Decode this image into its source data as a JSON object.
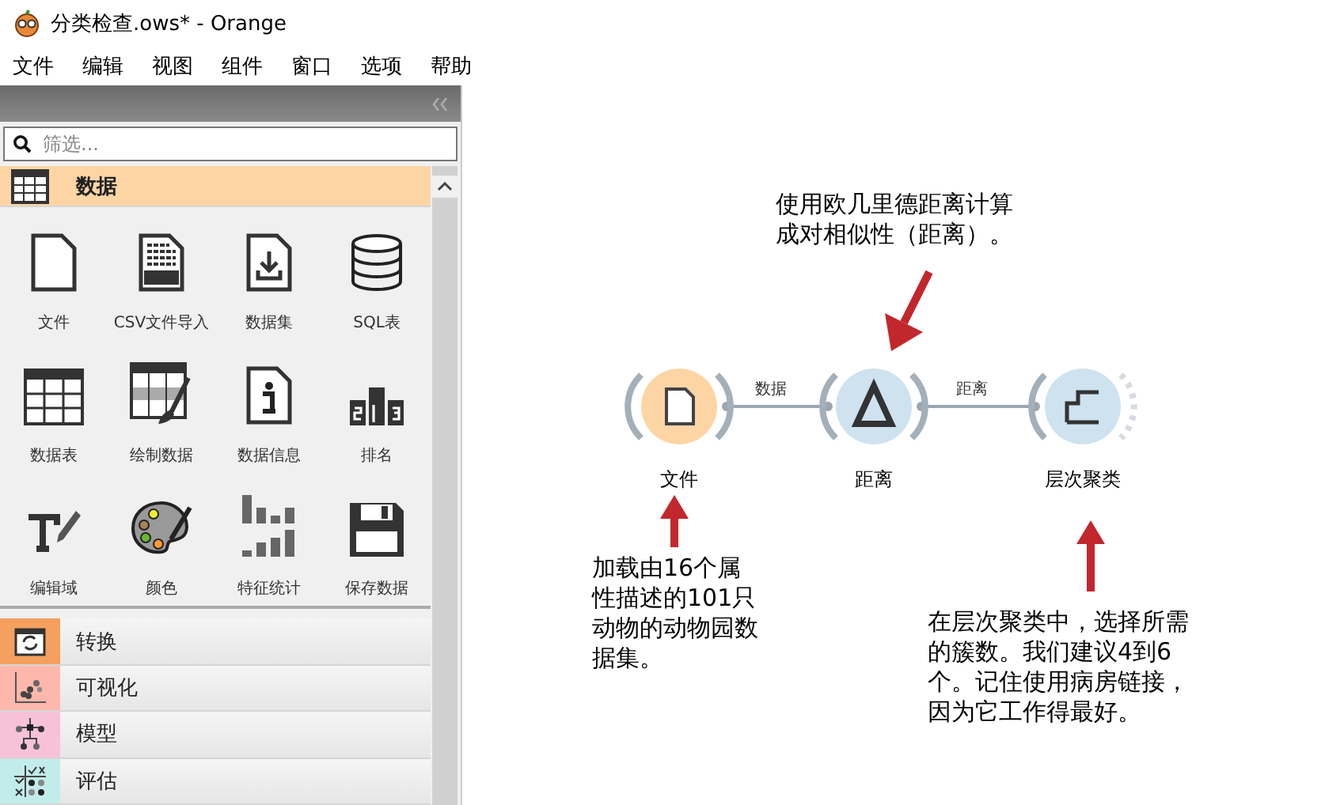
{
  "window": {
    "title": "分类检查.ows* - Orange"
  },
  "menu": [
    "文件",
    "编辑",
    "视图",
    "组件",
    "窗口",
    "选项",
    "帮助"
  ],
  "toolbox": {
    "filter": {
      "placeholder": "筛选..."
    },
    "categories": [
      {
        "label": "数据",
        "kind": "table",
        "expanded": true,
        "color": "#fdd5a5",
        "widgets": [
          {
            "label": "文件",
            "kind": "file"
          },
          {
            "label": "CSV文件导入",
            "kind": "csv"
          },
          {
            "label": "数据集",
            "kind": "dataset"
          },
          {
            "label": "SQL表",
            "kind": "sql"
          },
          {
            "label": "数据表",
            "kind": "table"
          },
          {
            "label": "绘制数据",
            "kind": "paint"
          },
          {
            "label": "数据信息",
            "kind": "info"
          },
          {
            "label": "排名",
            "kind": "rank"
          },
          {
            "label": "编辑域",
            "kind": "edit"
          },
          {
            "label": "颜色",
            "kind": "palette"
          },
          {
            "label": "特征统计",
            "kind": "stats"
          },
          {
            "label": "保存数据",
            "kind": "save"
          }
        ]
      },
      {
        "label": "转换",
        "kind": "transform",
        "expanded": false,
        "color": "#f5a05e"
      },
      {
        "label": "可视化",
        "kind": "scatter",
        "expanded": false,
        "color": "#fdb8ab"
      },
      {
        "label": "模型",
        "kind": "tree",
        "expanded": false,
        "color": "#f7c2d8"
      },
      {
        "label": "评估",
        "kind": "evaluate",
        "expanded": false,
        "color": "#c2ecea"
      }
    ]
  },
  "canvas": {
    "nodes": [
      {
        "label": "文件",
        "kind": "file",
        "color": "#fdd5a5"
      },
      {
        "label": "距离",
        "kind": "distance",
        "color": "#cfe2ef"
      },
      {
        "label": "层次聚类",
        "kind": "cluster",
        "color": "#cfe2ef"
      }
    ],
    "links": [
      {
        "label": "数据"
      },
      {
        "label": "距离"
      }
    ],
    "notes": [
      "使用欧几里德距离计算成对相似性（距离）。",
      "加载由16个属性描述的101只动物的动物园数据集。",
      "在层次聚类中，选择所需的簇数。我们建议4到6个。记住使用病房链接，因为它工作得最好。"
    ]
  }
}
